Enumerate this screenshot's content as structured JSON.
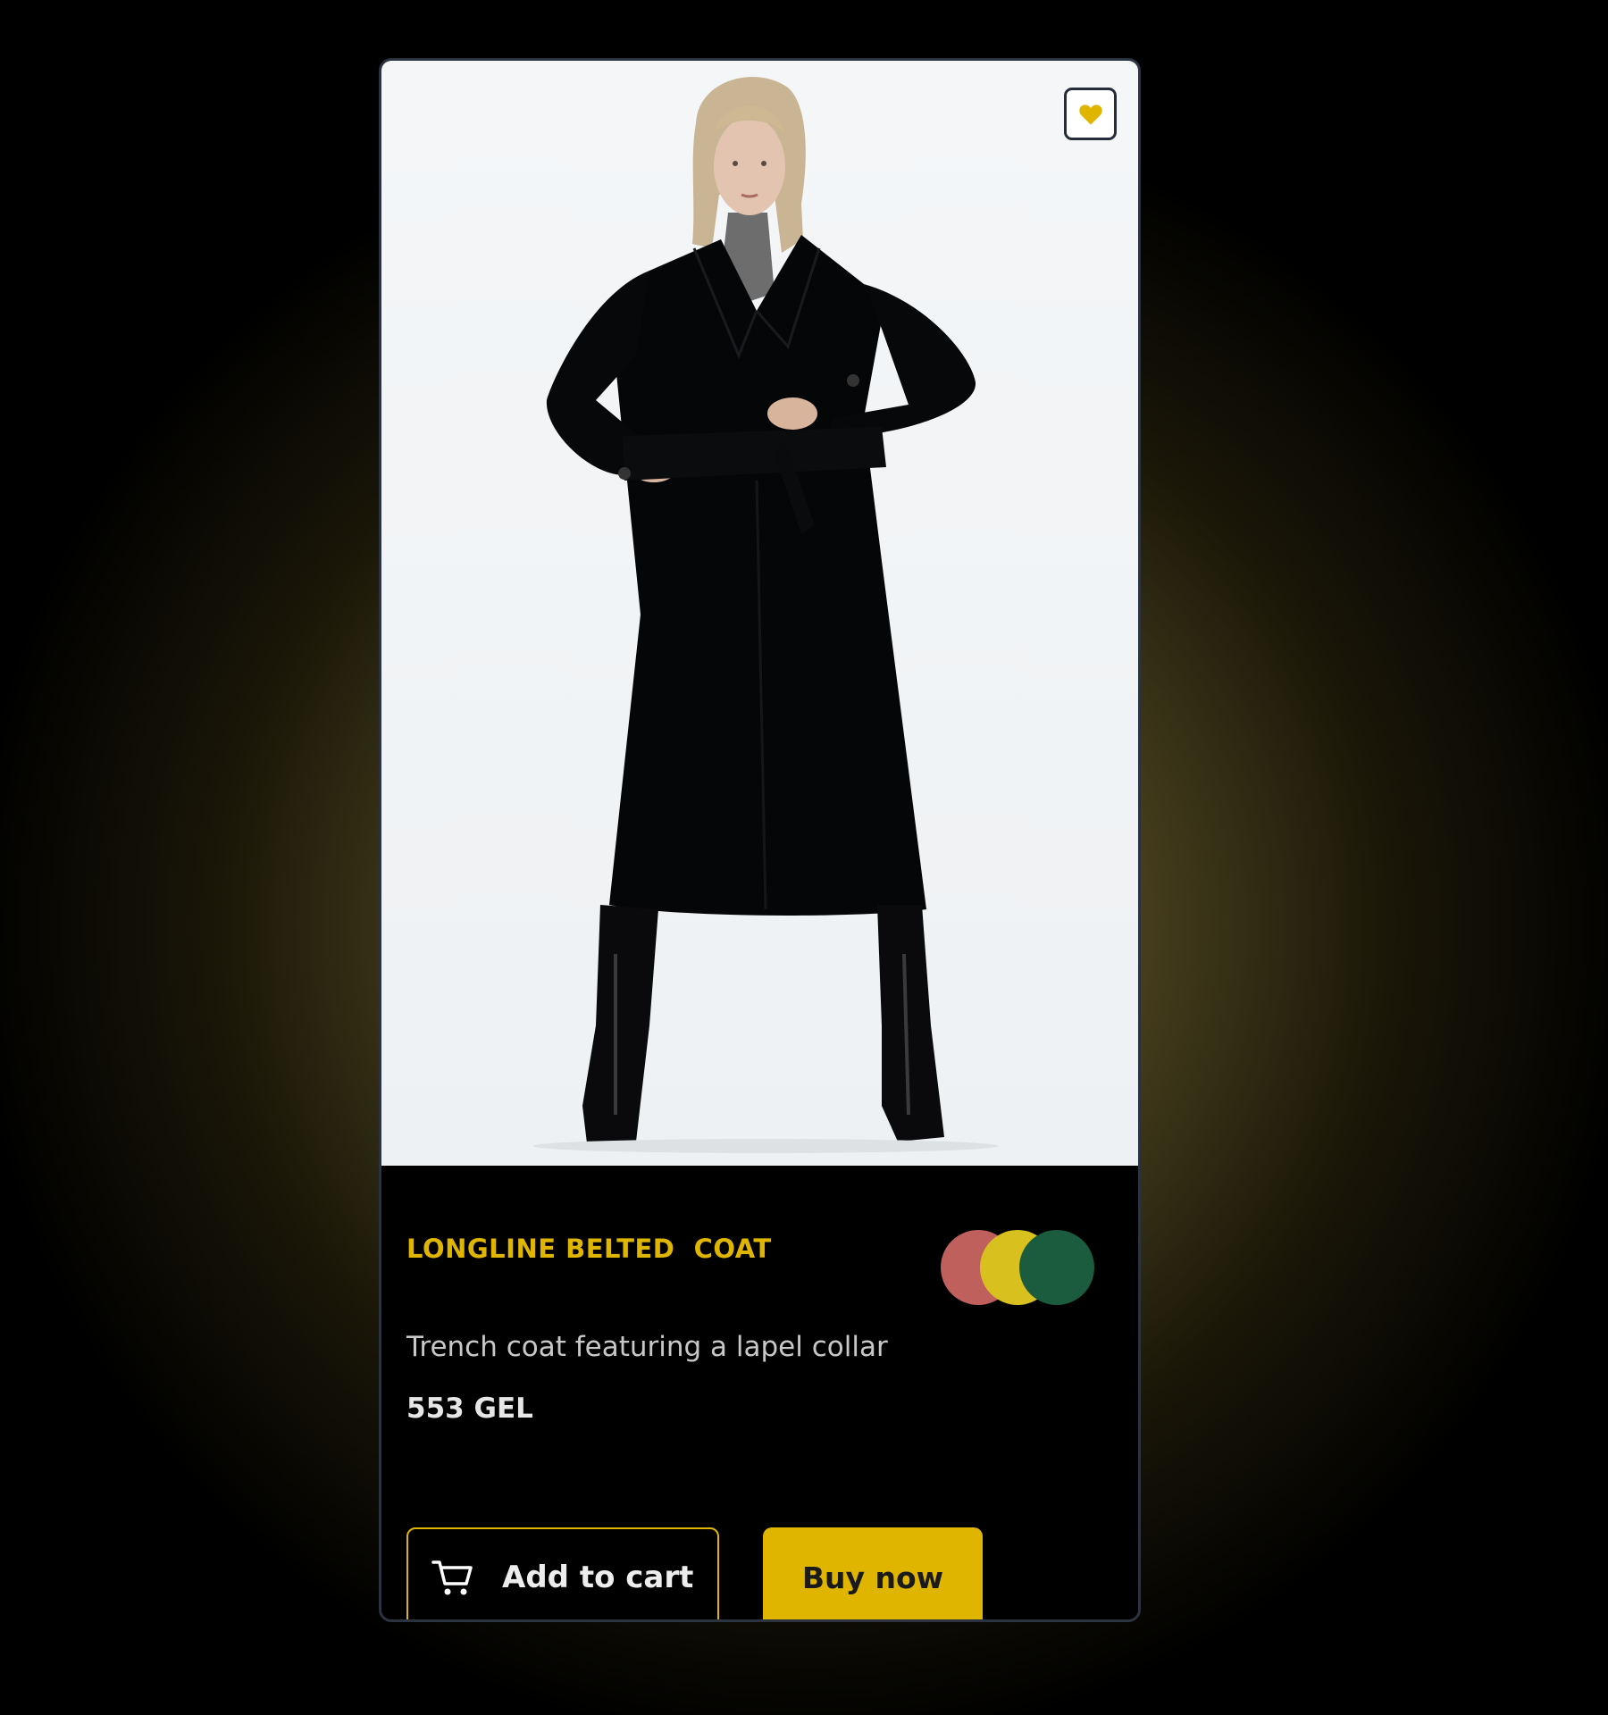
{
  "product": {
    "title": "LONGLINE BELTED  COAT",
    "description": "Trench coat featuring a lapel collar",
    "price": "553 GEL",
    "image_alt": "Model wearing a black longline belted coat",
    "favorite_icon": "heart-icon"
  },
  "swatches": [
    {
      "name": "red",
      "color": "#c0605d"
    },
    {
      "name": "yellow",
      "color": "#d8c11f"
    },
    {
      "name": "green",
      "color": "#1b5c3e"
    }
  ],
  "actions": {
    "add_to_cart_label": "Add to cart",
    "add_to_cart_icon": "cart-icon",
    "buy_now_label": "Buy now"
  },
  "colors": {
    "accent": "#dfb500",
    "card_background": "#000000",
    "card_border": "#2b3340",
    "photo_background": "#f2f4f6"
  }
}
